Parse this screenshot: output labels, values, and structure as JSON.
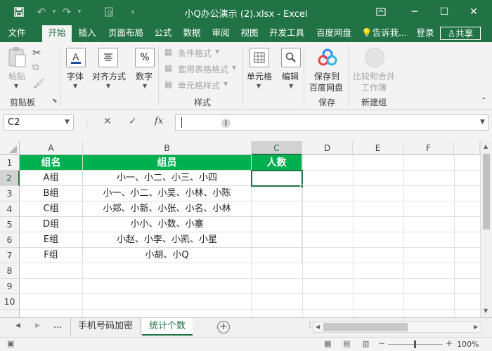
{
  "window": {
    "title": "小Q办公演示 (2).xlsx - Excel"
  },
  "tabs": [
    "文件",
    "开始",
    "插入",
    "页面布局",
    "公式",
    "数据",
    "审阅",
    "视图",
    "开发工具",
    "百度网盘"
  ],
  "tell_me": "告诉我...",
  "login": "登录",
  "share": "共享",
  "ribbon": {
    "paste": "粘贴",
    "clipboard_group": "剪贴板",
    "font": "字体",
    "align": "对齐方式",
    "number": "数字",
    "number_icon": "%",
    "cond_format": "条件格式",
    "table_format": "套用表格格式",
    "cell_style": "单元格样式",
    "styles_group": "样式",
    "cells": "单元格",
    "editing": "编辑",
    "save_to_baidu_1": "保存到",
    "save_to_baidu_2": "百度网盘",
    "save_group": "保存",
    "compare_merge_1": "比较和合并",
    "compare_merge_2": "工作簿",
    "new_group": "新建组"
  },
  "formula_bar": {
    "namebox": "C2",
    "fx": "fx",
    "formula": ""
  },
  "columns": [
    "A",
    "B",
    "C",
    "D",
    "E",
    "F"
  ],
  "rows": [
    "1",
    "2",
    "3",
    "4",
    "5",
    "6",
    "7",
    "8",
    "9",
    "10"
  ],
  "table": {
    "headers": [
      "组名",
      "组员",
      "人数"
    ],
    "data": [
      [
        "A组",
        "小一、小二、小三、小四",
        ""
      ],
      [
        "B组",
        "小一、小二、小吴、小林、小陈",
        ""
      ],
      [
        "C组",
        "小郑、小新、小张、小名、小林",
        ""
      ],
      [
        "D组",
        "小小、小数、小塞",
        ""
      ],
      [
        "E组",
        "小赵、小李、小凯、小星",
        ""
      ],
      [
        "F组",
        "小胡、小Q",
        ""
      ]
    ]
  },
  "sheets": {
    "ellipsis": "...",
    "tab1": "手机号码加密",
    "tab2": "统计个数"
  },
  "status": {
    "zoom": "100%"
  },
  "colors": {
    "excel_green": "#217346",
    "header_fill": "#00b050"
  }
}
